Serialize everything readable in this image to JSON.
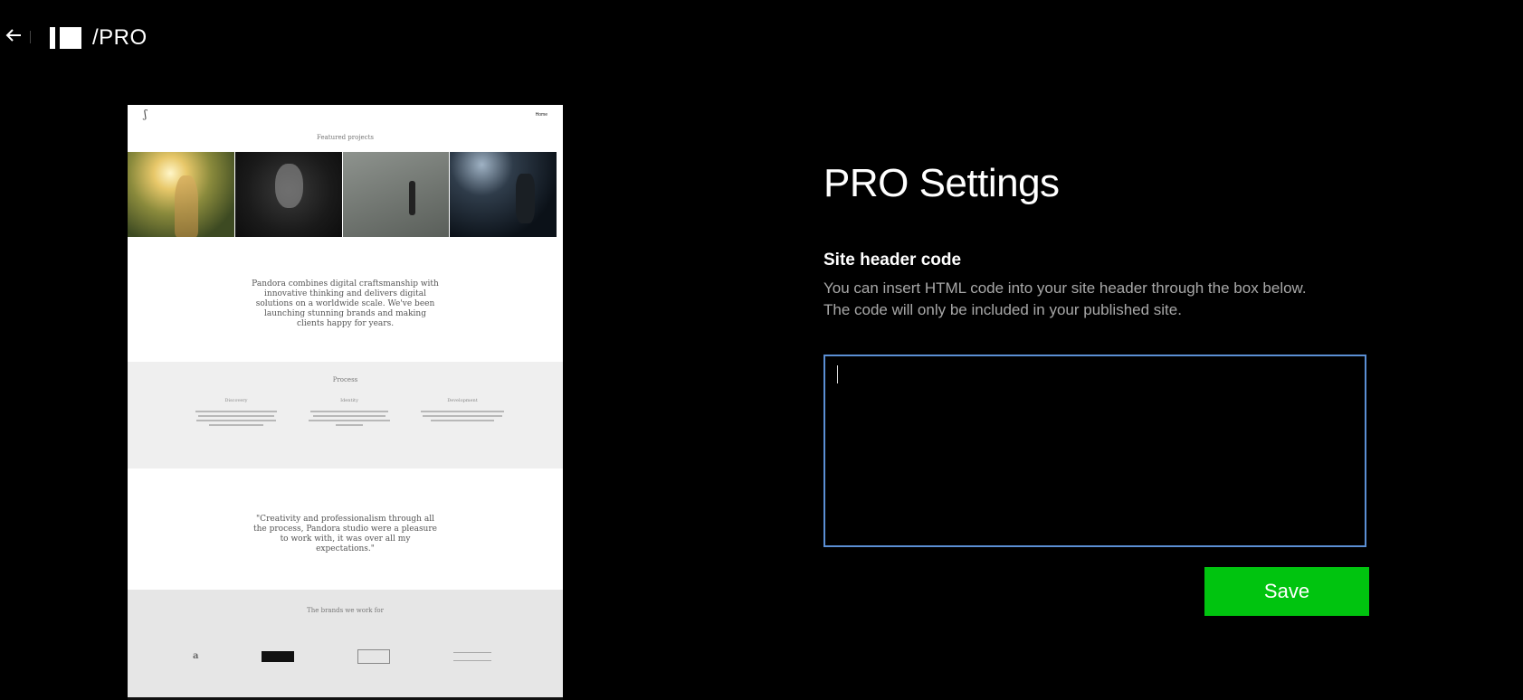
{
  "topbar": {
    "back_icon": "arrow-left-icon",
    "logo_icon": "brand-logo-icon",
    "pro_label": "/PRO"
  },
  "preview": {
    "nav_home": "Home",
    "featured_title": "Featured projects",
    "intro_text": "Pandora combines digital craftsmanship with innovative thinking and delivers digital solutions on a worldwide scale. We've been launching stunning brands and making clients happy for years.",
    "process_title": "Process",
    "process_columns": [
      "Discovery",
      "Identity",
      "Development"
    ],
    "quote": "\"Creativity and professionalism through all the process, Pandora studio were a pleasure to work with, it was over all my expectations.\"",
    "brands_title": "The brands we work for"
  },
  "settings": {
    "title": "PRO Settings",
    "section_title": "Site header code",
    "description_line1": "You can insert HTML code into your site header through the box below.",
    "description_line2": "The code will only be included in your published site.",
    "code_value": "",
    "save_label": "Save"
  },
  "colors": {
    "background": "#000000",
    "accent_save": "#00c40f",
    "focus_border": "#5b8fd4",
    "muted_text": "#a8a8a8"
  }
}
